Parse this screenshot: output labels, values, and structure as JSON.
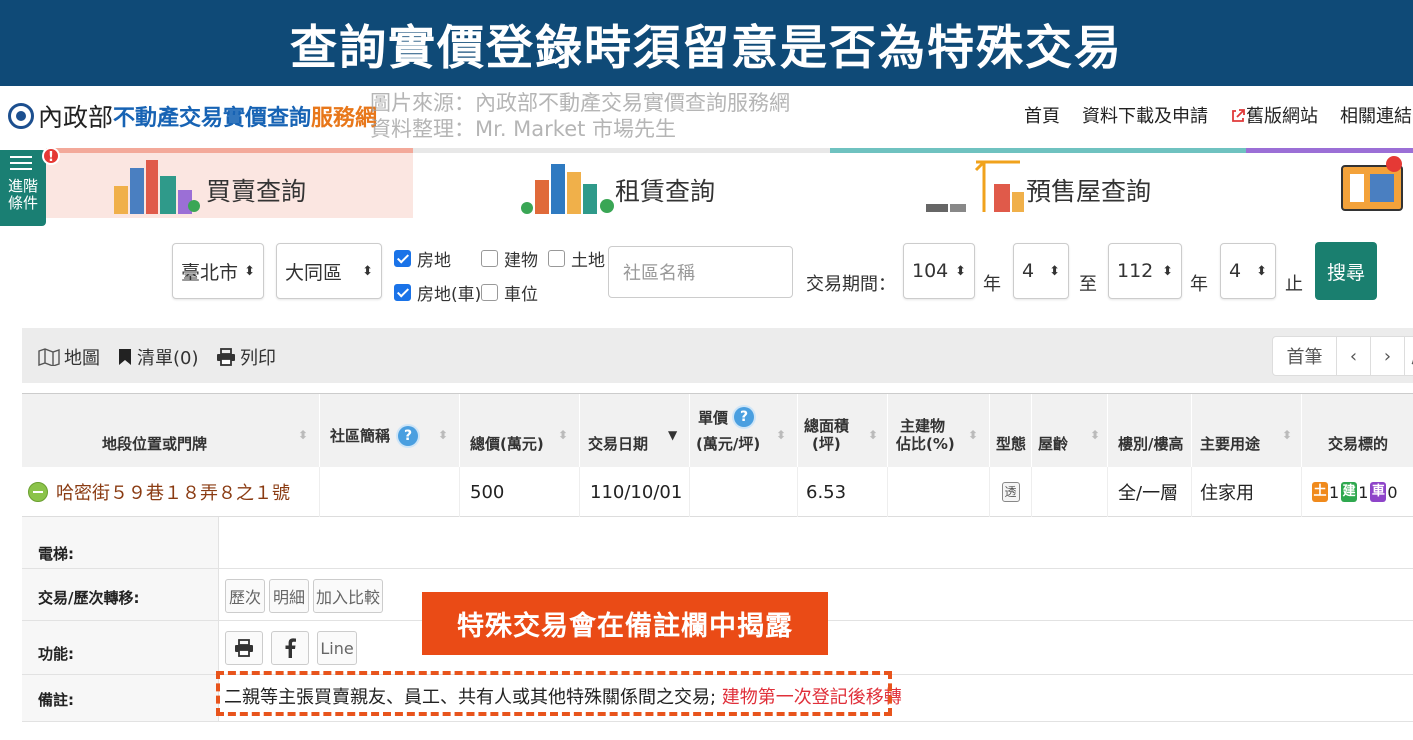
{
  "banner": {
    "title": "查詢實價登錄時須留意是否為特殊交易"
  },
  "header": {
    "logo_a": "內政部",
    "logo_b": "不動產交易實價查詢",
    "logo_c": "服務網",
    "watermark_line1": "圖片來源：內政部不動產交易實價查詢服務網",
    "watermark_line2": "資料整理：Mr. Market 市場先生",
    "nav": [
      "首頁",
      "資料下載及申請",
      "舊版網站",
      "相關連結"
    ]
  },
  "side_filter": {
    "label_line1": "進階",
    "label_line2": "條件",
    "badge": "!"
  },
  "tabs": [
    {
      "label": "買賣查詢",
      "bar_color": "#f3a99a"
    },
    {
      "label": "租賃查詢",
      "bar_color": "#e8e8e8"
    },
    {
      "label": "預售屋查詢",
      "bar_color": "#6fc2c0"
    },
    {
      "label": "",
      "bar_color": "#9b6fd6"
    }
  ],
  "search": {
    "city": "臺北市",
    "district": "大同區",
    "checks": [
      {
        "label": "房地",
        "checked": true
      },
      {
        "label": "建物",
        "checked": false
      },
      {
        "label": "土地",
        "checked": false
      },
      {
        "label": "房地(車)",
        "checked": true
      },
      {
        "label": "車位",
        "checked": false
      }
    ],
    "community_placeholder": "社區名稱",
    "period_label": "交易期間：",
    "from_year": "104",
    "from_month": "4",
    "to_year": "112",
    "to_month": "4",
    "year_unit": "年",
    "to_word": "至",
    "end_word": "止",
    "submit": "搜尋"
  },
  "toolbar": {
    "map": "地圖",
    "list": "清單(0)",
    "print": "列印",
    "pager": [
      "首筆",
      "‹",
      "›",
      "尾"
    ]
  },
  "table": {
    "headers": [
      "地段位置或門牌",
      "社區簡稱",
      "總價(萬元)",
      "交易日期",
      "單價",
      "(萬元/坪)",
      "總面積",
      "(坪)",
      "主建物",
      "佔比(%)",
      "型態",
      "屋齡",
      "樓別/樓高",
      "主要用途",
      "交易標的"
    ],
    "row": {
      "address": "哈密街５９巷１８弄８之１號",
      "community": "",
      "total_price": "500",
      "date": "110/10/01",
      "unit_price": "",
      "area": "6.53",
      "main_ratio": "",
      "type_icon": "透",
      "age": "",
      "floor": "全/一層",
      "usage": "住家用",
      "tags": [
        {
          "char": "土",
          "count": "1",
          "color": "#f08a1c"
        },
        {
          "char": "建",
          "count": "1",
          "color": "#2fa84f"
        },
        {
          "char": "車",
          "count": "0",
          "color": "#8e44c9"
        }
      ]
    }
  },
  "detail": {
    "elevator_label": "電梯:",
    "transfer_label": "交易/歷次轉移:",
    "transfer_buttons": [
      "歷次",
      "明細",
      "加入比較"
    ],
    "function_label": "功能:",
    "function_line": "Line",
    "note_label": "備註:",
    "note_text": "二親等主張買賣親友、員工、共有人或其他特殊關係間之交易; ",
    "note_red": "建物第一次登記後移轉"
  },
  "callout": "特殊交易會在備註欄中揭露"
}
